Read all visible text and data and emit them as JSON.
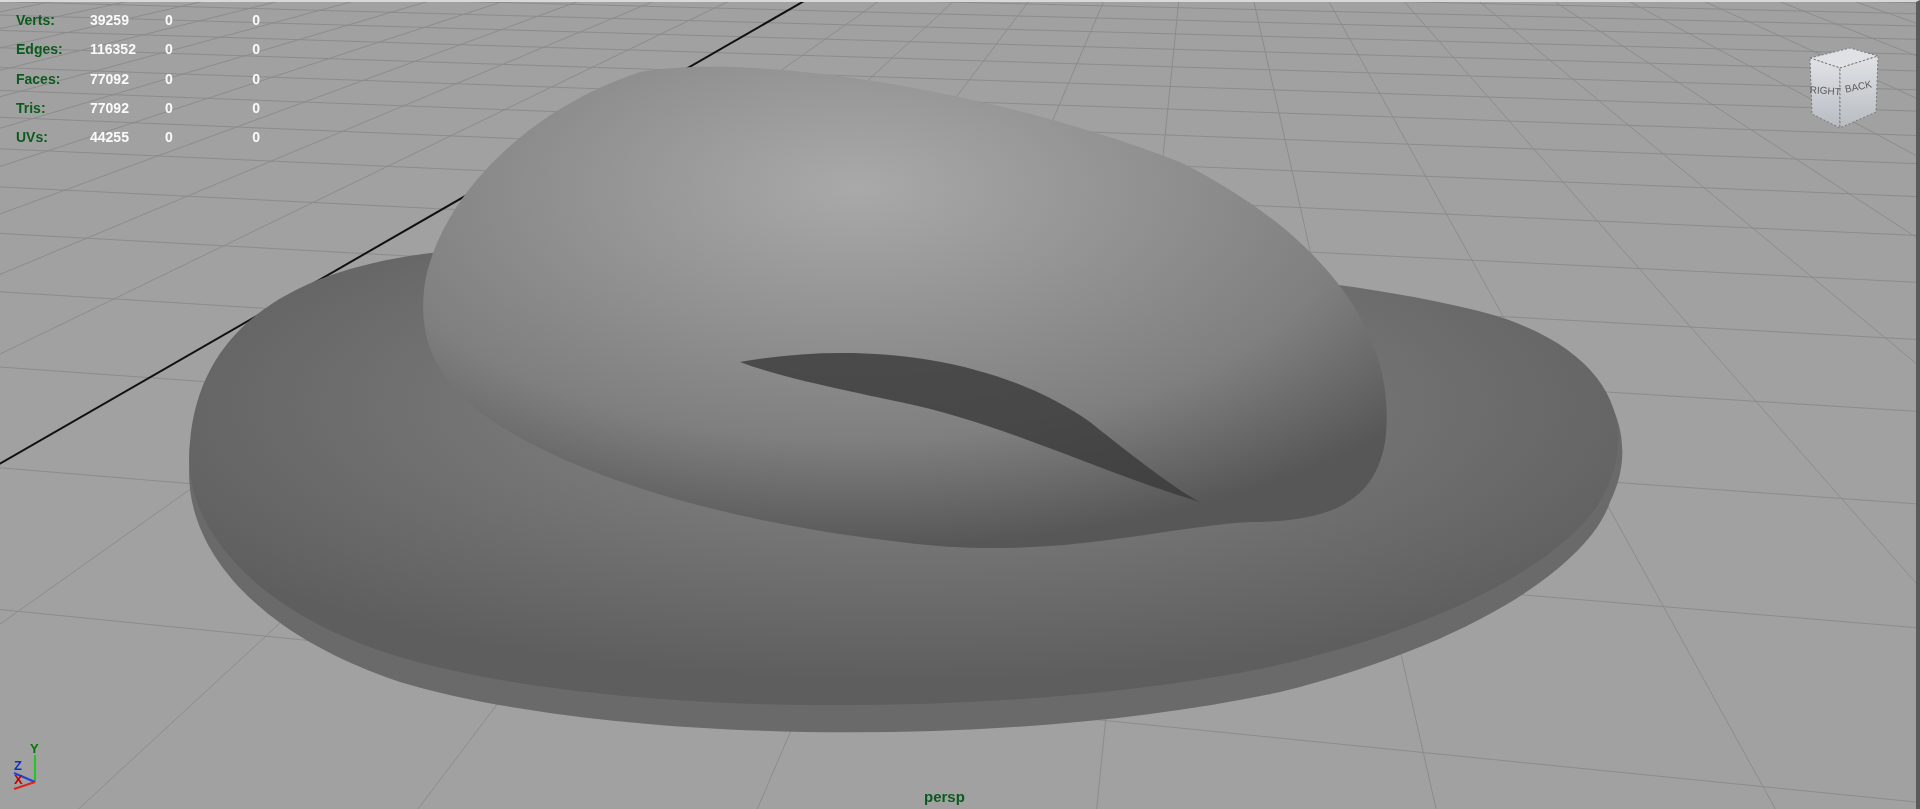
{
  "viewport": {
    "hud_stats": [
      {
        "label": "Verts:",
        "values": [
          "39259",
          "0",
          "0"
        ]
      },
      {
        "label": "Edges:",
        "values": [
          "116352",
          "0",
          "0"
        ]
      },
      {
        "label": "Faces:",
        "values": [
          "77092",
          "0",
          "0"
        ]
      },
      {
        "label": "Tris:",
        "values": [
          "77092",
          "0",
          "0"
        ]
      },
      {
        "label": "UVs:",
        "values": [
          "44255",
          "0",
          "0"
        ]
      }
    ],
    "view_cube": {
      "faces": [
        "RIGHT",
        "BACK"
      ]
    },
    "axis_indicator": {
      "labels": [
        "Y",
        "Z",
        "X"
      ]
    },
    "camera_label": "persp"
  }
}
